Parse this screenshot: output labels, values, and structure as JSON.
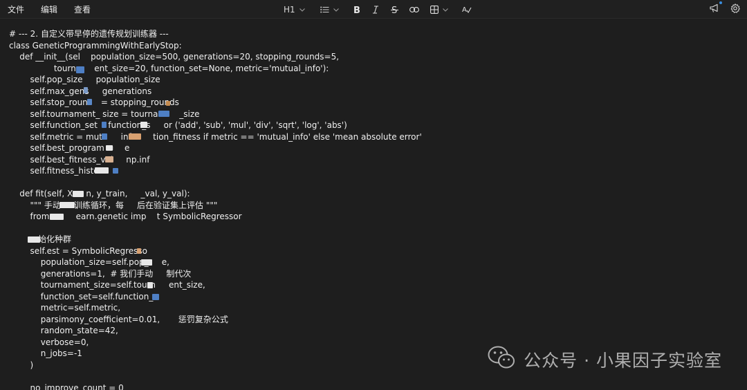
{
  "menu": [
    "文件",
    "编辑",
    "查看"
  ],
  "toolbar": {
    "heading": "H1"
  },
  "code_lines": [
    "# --- 2. 自定义带早停的遗传规划训练器 ---",
    "class GeneticProgrammingWithEarlyStop:",
    "    def __init__(sel    population_size=500, generations=20, stopping_rounds=5,",
    "                 tourna     ent_size=20, function_set=None, metric='mutual_info'):",
    "        self.pop_size     population_size",
    "        self.max_gens     generations",
    "        self.stop_roun     = stopping_rounds",
    "        self.tournament_ size = tournam     _size",
    "        self.function_set    function_s     or ('add', 'sub', 'mul', 'div', 'sqrt', 'log', 'abs')",
    "        self.metric = mutu     infor     tion_fitness if metric == 'mutual_info' else 'mean absolute error'",
    "        self.best_program =    e",
    "        self.best_fitness_val     np.inf",
    "        self.fitness_histo",
    "",
    "    def fit(self, X     n, y_train,     _val, y_val):",
    "        \"\"\" 手动     训练循环，每     后在验证集上评估 \"\"\"",
    "        from          earn.genetic imp    t SymbolicRegressor",
    "",
    "           始化种群",
    "        self.est = SymbolicRegresso",
    "            population_size=self.pop_     e,",
    "            generations=1,  # 我们手动     制代次",
    "            tournament_size=self.tourn     ent_size,",
    "            function_set=self.function_s",
    "            metric=self.metric,",
    "            parsimony_coefficient=0.01,       惩罚复杂公式",
    "            random_state=42,",
    "            verbose=0,",
    "            n_jobs=-1",
    "        )",
    "",
    "        no_improve_count = 0"
  ],
  "watermark": {
    "text": "公众号 · 小果因子实验室"
  },
  "icons": {
    "list": "list-icon",
    "bold": "bold-icon",
    "italic": "italic-icon",
    "strike": "strikethrough-icon",
    "link": "link-icon",
    "table": "table-icon",
    "spell": "spellcheck-icon",
    "announce": "megaphone-icon",
    "settings": "gear-icon"
  },
  "colors": {
    "background": "#1e1e1e",
    "text": "#f0f0f0",
    "notification_dot": "#3a8dde"
  }
}
